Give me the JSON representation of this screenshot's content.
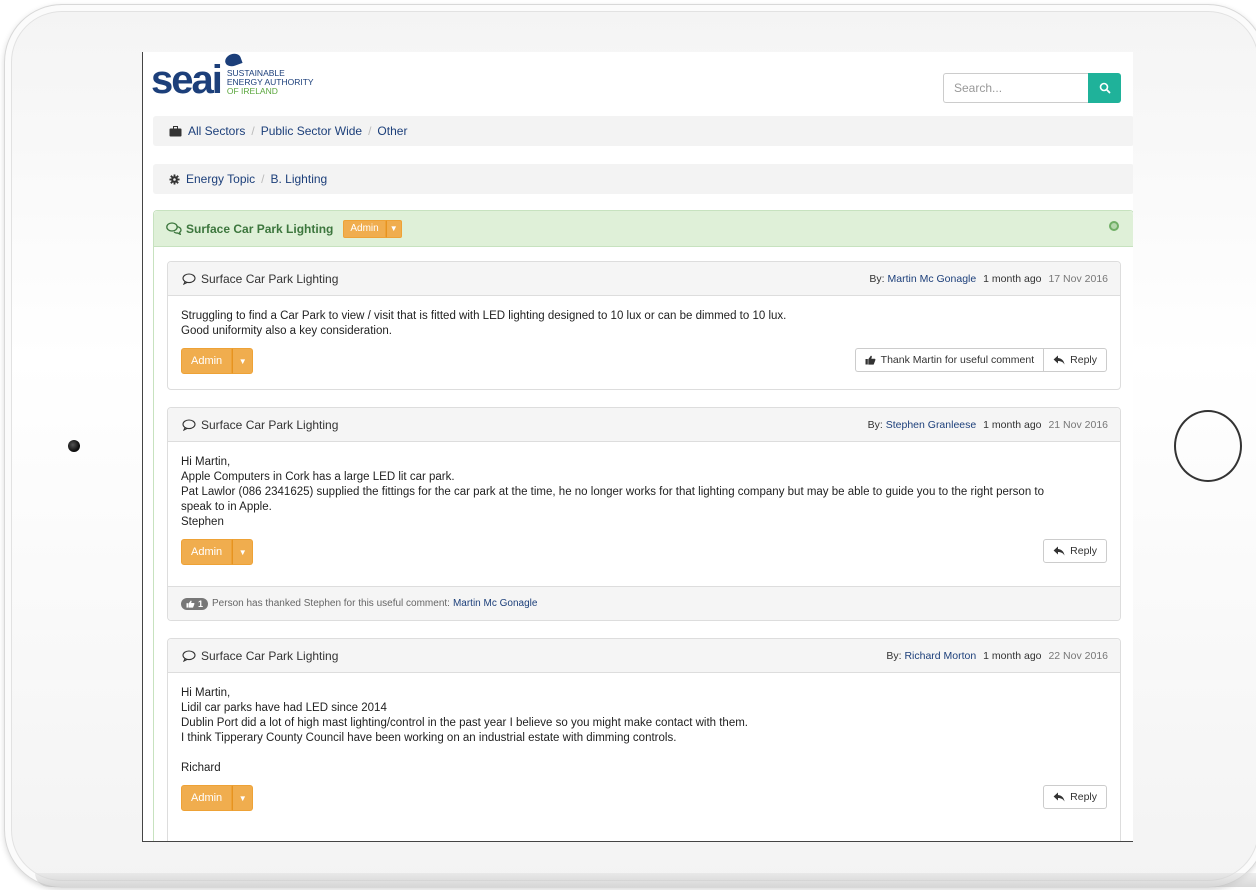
{
  "logo": {
    "word": "seai",
    "line1": "SUSTAINABLE",
    "line2": "ENERGY AUTHORITY",
    "line3": "OF IRELAND"
  },
  "search": {
    "placeholder": "Search..."
  },
  "breadcrumb_sector": {
    "items": [
      "All Sectors",
      "Public Sector Wide",
      "Other"
    ]
  },
  "breadcrumb_topic": {
    "items": [
      "Energy Topic",
      "B. Lighting"
    ]
  },
  "topic": {
    "title": "Surface Car Park Lighting",
    "admin_label": "Admin"
  },
  "posts": [
    {
      "title": "Surface Car Park Lighting",
      "by_label": "By:",
      "author": "Martin Mc Gonagle",
      "ago": "1 month ago",
      "date": "17 Nov 2016",
      "lines": [
        "Struggling to find a Car Park to view / visit that is fitted with LED lighting designed to 10 lux or can be dimmed to 10 lux.",
        "Good uniformity also a key consideration."
      ],
      "admin_label": "Admin",
      "thank_label": "Thank Martin for useful comment",
      "reply_label": "Reply"
    },
    {
      "title": "Surface Car Park Lighting",
      "by_label": "By:",
      "author": "Stephen Granleese",
      "ago": "1 month ago",
      "date": "21 Nov 2016",
      "lines": [
        "Hi Martin,",
        "Apple Computers in Cork has a large LED lit car park.",
        "Pat Lawlor (086 2341625) supplied the fittings for the car park at the time, he no longer works for that lighting company but may be able to guide you to the right person to",
        "speak to in Apple.",
        "Stephen"
      ],
      "admin_label": "Admin",
      "reply_label": "Reply",
      "thanks_count": "1",
      "thanks_text": "Person has thanked Stephen for this useful comment:",
      "thanks_by": "Martin Mc Gonagle"
    },
    {
      "title": "Surface Car Park Lighting",
      "by_label": "By:",
      "author": "Richard Morton",
      "ago": "1 month ago",
      "date": "22 Nov 2016",
      "lines": [
        "Hi Martin,",
        "Lidil car parks have had LED since 2014",
        "Dublin Port did a lot of high mast lighting/control in the past year I believe so you might make contact with them.",
        "I think Tipperary County Council have been working on an industrial estate with dimming controls.",
        "",
        "Richard"
      ],
      "admin_label": "Admin",
      "reply_label": "Reply"
    }
  ],
  "colors": {
    "brand": "#1c3f7a",
    "accent": "#1fb29a",
    "admin": "#f0ad4e",
    "topic_bg": "#dff0d8",
    "topic_text": "#3c763d"
  }
}
